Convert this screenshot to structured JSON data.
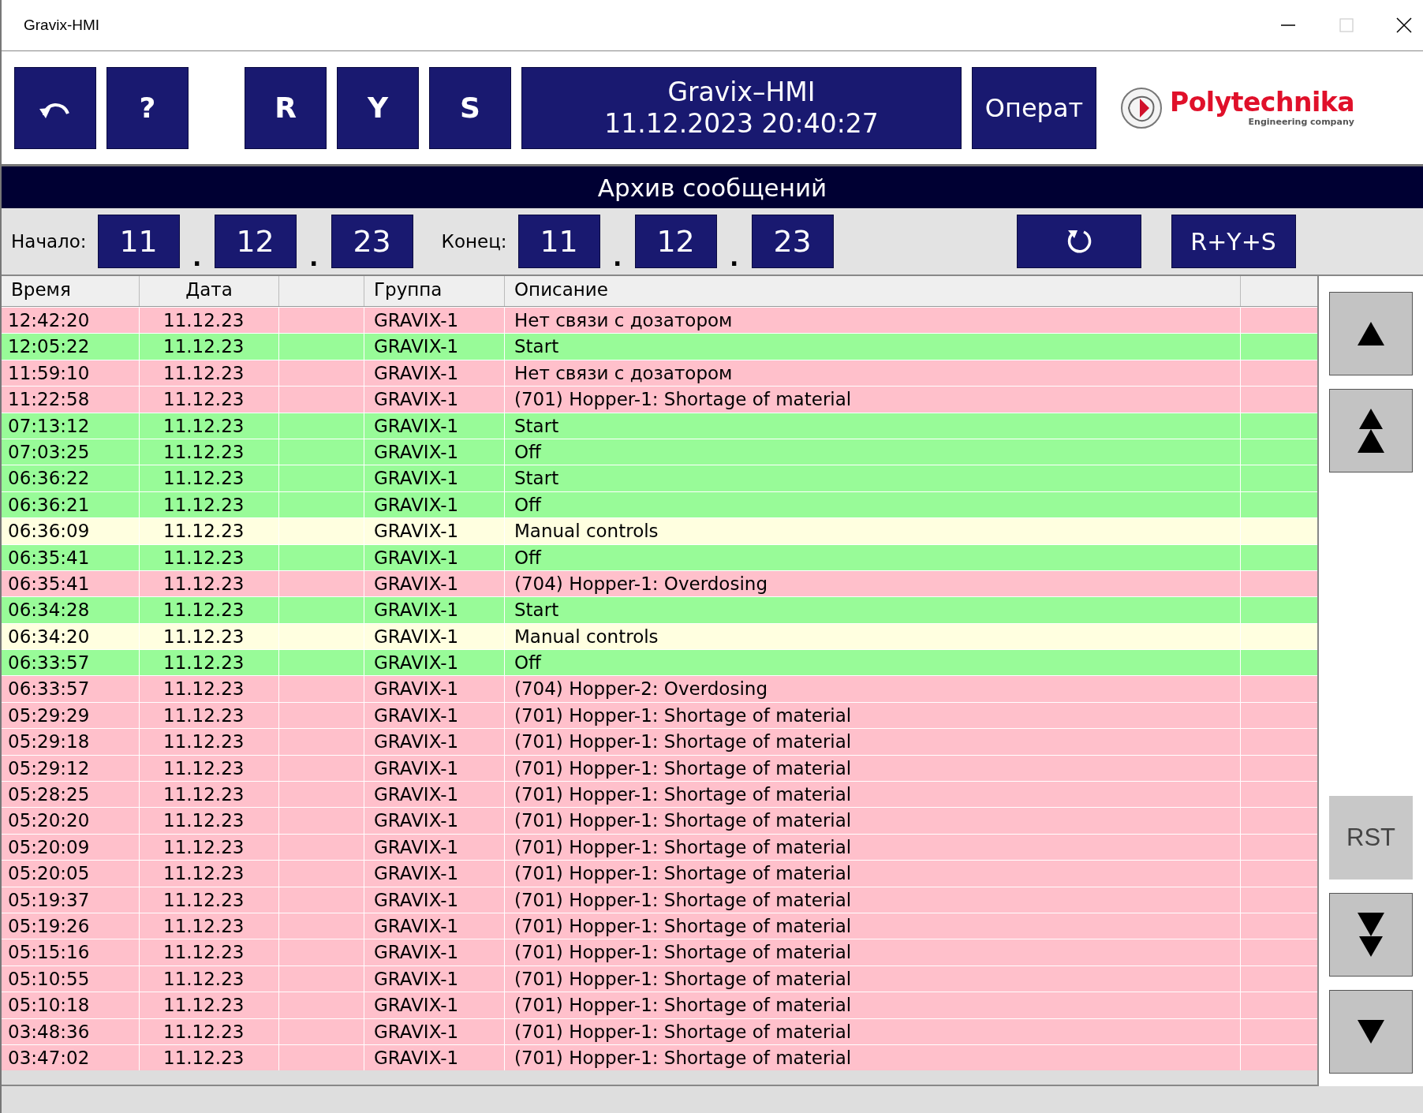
{
  "window": {
    "title": "Gravix-HMI"
  },
  "toolbar": {
    "help": "?",
    "buttons": [
      "R",
      "Y",
      "S"
    ],
    "title": "Gravix–HMI",
    "datetime": "11.12.2023 20:40:27",
    "user": "Операт"
  },
  "logo": {
    "name": "Polytechnika",
    "tagline": "Engineering company"
  },
  "page_title": "Архив сообщений",
  "filter": {
    "start": {
      "label": "Начало:",
      "parts": [
        "11",
        "12",
        "23"
      ]
    },
    "end": {
      "label": "Конец:",
      "parts": [
        "11",
        "12",
        "23"
      ]
    },
    "separator": ".",
    "all_button": "R+Y+S"
  },
  "table": {
    "columns": [
      {
        "kind": "text",
        "label": "Время"
      },
      {
        "kind": "text",
        "label": "Дата"
      },
      {
        "kind": "blank"
      },
      {
        "kind": "text",
        "label": "Группа"
      },
      {
        "kind": "text",
        "label": "Описание"
      },
      {
        "kind": "blank"
      }
    ],
    "rows": [
      {
        "kind": "alarm",
        "time": "12:42:20",
        "date": "11.12.23",
        "group": "GRAVIX-1",
        "description": "Нет связи с дозатором"
      },
      {
        "kind": "event",
        "time": "12:05:22",
        "date": "11.12.23",
        "group": "GRAVIX-1",
        "description": "Start"
      },
      {
        "kind": "alarm",
        "time": "11:59:10",
        "date": "11.12.23",
        "group": "GRAVIX-1",
        "description": "Нет связи с дозатором"
      },
      {
        "kind": "alarm",
        "time": "11:22:58",
        "date": "11.12.23",
        "group": "GRAVIX-1",
        "description": "(701) Hopper-1: Shortage of material"
      },
      {
        "kind": "event",
        "time": "07:13:12",
        "date": "11.12.23",
        "group": "GRAVIX-1",
        "description": "Start"
      },
      {
        "kind": "event",
        "time": "07:03:25",
        "date": "11.12.23",
        "group": "GRAVIX-1",
        "description": "Off"
      },
      {
        "kind": "event",
        "time": "06:36:22",
        "date": "11.12.23",
        "group": "GRAVIX-1",
        "description": "Start"
      },
      {
        "kind": "event",
        "time": "06:36:21",
        "date": "11.12.23",
        "group": "GRAVIX-1",
        "description": "Off"
      },
      {
        "kind": "manual",
        "time": "06:36:09",
        "date": "11.12.23",
        "group": "GRAVIX-1",
        "description": "Manual controls"
      },
      {
        "kind": "event",
        "time": "06:35:41",
        "date": "11.12.23",
        "group": "GRAVIX-1",
        "description": "Off"
      },
      {
        "kind": "alarm",
        "time": "06:35:41",
        "date": "11.12.23",
        "group": "GRAVIX-1",
        "description": "(704) Hopper-1: Overdosing"
      },
      {
        "kind": "event",
        "time": "06:34:28",
        "date": "11.12.23",
        "group": "GRAVIX-1",
        "description": "Start"
      },
      {
        "kind": "manual",
        "time": "06:34:20",
        "date": "11.12.23",
        "group": "GRAVIX-1",
        "description": "Manual controls"
      },
      {
        "kind": "event",
        "time": "06:33:57",
        "date": "11.12.23",
        "group": "GRAVIX-1",
        "description": "Off"
      },
      {
        "kind": "alarm",
        "time": "06:33:57",
        "date": "11.12.23",
        "group": "GRAVIX-1",
        "description": "(704) Hopper-2: Overdosing"
      },
      {
        "kind": "alarm",
        "time": "05:29:29",
        "date": "11.12.23",
        "group": "GRAVIX-1",
        "description": "(701) Hopper-1: Shortage of material"
      },
      {
        "kind": "alarm",
        "time": "05:29:18",
        "date": "11.12.23",
        "group": "GRAVIX-1",
        "description": "(701) Hopper-1: Shortage of material"
      },
      {
        "kind": "alarm",
        "time": "05:29:12",
        "date": "11.12.23",
        "group": "GRAVIX-1",
        "description": "(701) Hopper-1: Shortage of material"
      },
      {
        "kind": "alarm",
        "time": "05:28:25",
        "date": "11.12.23",
        "group": "GRAVIX-1",
        "description": "(701) Hopper-1: Shortage of material"
      },
      {
        "kind": "alarm",
        "time": "05:20:20",
        "date": "11.12.23",
        "group": "GRAVIX-1",
        "description": "(701) Hopper-1: Shortage of material"
      },
      {
        "kind": "alarm",
        "time": "05:20:09",
        "date": "11.12.23",
        "group": "GRAVIX-1",
        "description": "(701) Hopper-1: Shortage of material"
      },
      {
        "kind": "alarm",
        "time": "05:20:05",
        "date": "11.12.23",
        "group": "GRAVIX-1",
        "description": "(701) Hopper-1: Shortage of material"
      },
      {
        "kind": "alarm",
        "time": "05:19:37",
        "date": "11.12.23",
        "group": "GRAVIX-1",
        "description": "(701) Hopper-1: Shortage of material"
      },
      {
        "kind": "alarm",
        "time": "05:19:26",
        "date": "11.12.23",
        "group": "GRAVIX-1",
        "description": "(701) Hopper-1: Shortage of material"
      },
      {
        "kind": "alarm",
        "time": "05:15:16",
        "date": "11.12.23",
        "group": "GRAVIX-1",
        "description": "(701) Hopper-1: Shortage of material"
      },
      {
        "kind": "alarm",
        "time": "05:10:55",
        "date": "11.12.23",
        "group": "GRAVIX-1",
        "description": "(701) Hopper-1: Shortage of material"
      },
      {
        "kind": "alarm",
        "time": "05:10:18",
        "date": "11.12.23",
        "group": "GRAVIX-1",
        "description": "(701) Hopper-1: Shortage of material"
      },
      {
        "kind": "alarm",
        "time": "03:48:36",
        "date": "11.12.23",
        "group": "GRAVIX-1",
        "description": "(701) Hopper-1: Shortage of material"
      },
      {
        "kind": "alarm",
        "time": "03:47:02",
        "date": "11.12.23",
        "group": "GRAVIX-1",
        "description": "(701) Hopper-1: Shortage of material"
      }
    ]
  },
  "side_buttons": [
    {
      "kind": "up",
      "disabled": false
    },
    {
      "kind": "page_up",
      "disabled": false
    },
    {
      "kind": "reset",
      "label": "RST",
      "disabled": true
    },
    {
      "kind": "page_down",
      "disabled": false
    },
    {
      "kind": "down",
      "disabled": false
    }
  ]
}
